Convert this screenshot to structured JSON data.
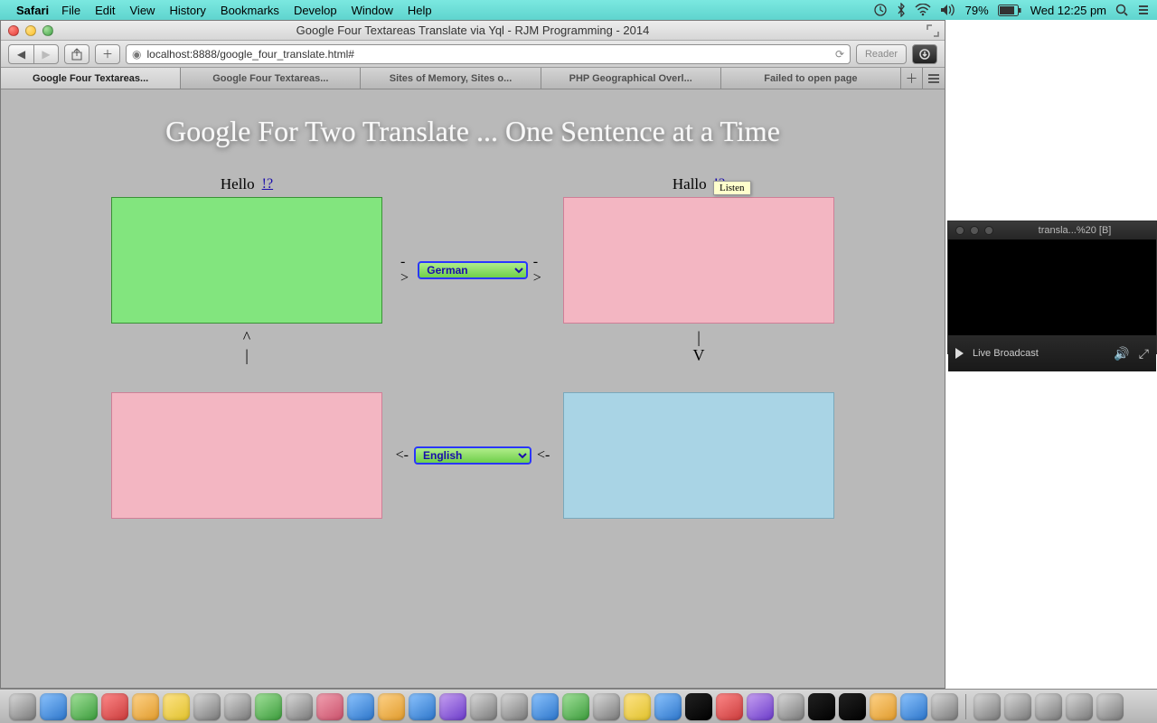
{
  "menubar": {
    "app": "Safari",
    "items": [
      "File",
      "Edit",
      "View",
      "History",
      "Bookmarks",
      "Develop",
      "Window",
      "Help"
    ],
    "battery_pct": "79%",
    "clock": "Wed 12:25 pm"
  },
  "window": {
    "title": "Google Four Textareas Translate via Yql - RJM Programming - 2014",
    "url": "localhost:8888/google_four_translate.html#",
    "reader_label": "Reader"
  },
  "tabs": [
    "Google Four Textareas...",
    "Google Four Textareas...",
    "Sites of Memory, Sites o...",
    "PHP Geographical Overl...",
    "Failed to open page"
  ],
  "page": {
    "heading": "Google For Two Translate ... One Sentence at a Time",
    "top_left_label": "Hello",
    "top_right_label": "Hallo",
    "listen_link": "!?",
    "tooltip": "Listen",
    "arrow_right": "->",
    "arrow_left": "<-",
    "arrow_up": "^\n|",
    "arrow_down": "|\nV",
    "lang_top": "German",
    "lang_bottom": "English"
  },
  "quicktime": {
    "title": "transla...%20 [B]",
    "status": "Live Broadcast"
  }
}
